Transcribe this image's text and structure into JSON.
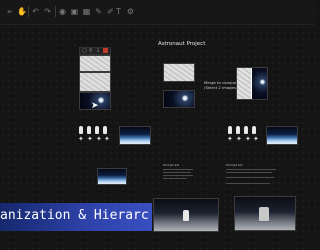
{
  "toolbar": {
    "icons": [
      "select-tool-icon",
      "hand-tool-icon",
      "undo-icon",
      "redo-icon",
      "view-icon",
      "frame-icon",
      "grid-icon",
      "pen-icon",
      "brush-icon",
      "text-icon",
      "settings-icon"
    ]
  },
  "canvas": {
    "board_title": "Astronaut Project",
    "merge_note": "Merge to compare\n(Select 2 images)",
    "note_left_title": "Prompt list",
    "note_right_title": "Prompt list"
  },
  "banner": {
    "text": "anization & Hierarchy"
  },
  "colors": {
    "background": "#141414",
    "banner": "#2d41a8",
    "accent_red": "#c0392b"
  }
}
